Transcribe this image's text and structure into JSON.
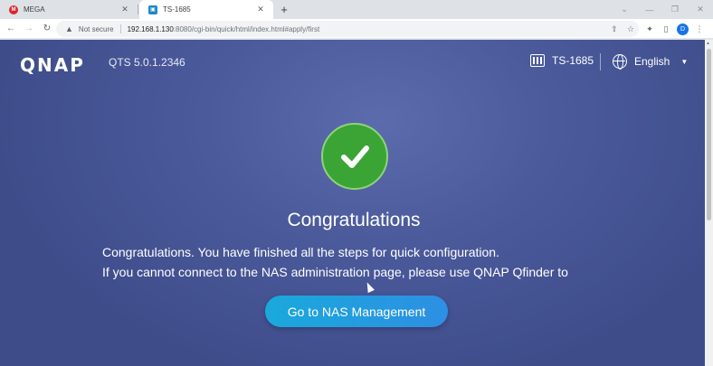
{
  "browser": {
    "tabs": [
      {
        "title": "MEGA",
        "favicon": "M",
        "active": false
      },
      {
        "title": "TS-1685",
        "favicon": "▣",
        "active": true
      }
    ],
    "new_tab_label": "+",
    "security_label": "Not secure",
    "url_host": "192.168.1.130",
    "url_path": ":8080/cgi-bin/quick/html/index.html#apply/first",
    "profile_initial": "D"
  },
  "header": {
    "logo": "QNAP",
    "version": "QTS 5.0.1.2346",
    "device_name": "TS-1685",
    "language": "English"
  },
  "main": {
    "title": "Congratulations",
    "message_line1": "Congratulations. You have finished all the steps for quick configuration.",
    "message_line2": "If you cannot connect to the NAS administration page, please use QNAP Qfinder to",
    "button_label": "Go to NAS Management"
  },
  "colors": {
    "background": "#4b5a9b",
    "success": "#3aa435",
    "button": "#1aa9dc"
  }
}
